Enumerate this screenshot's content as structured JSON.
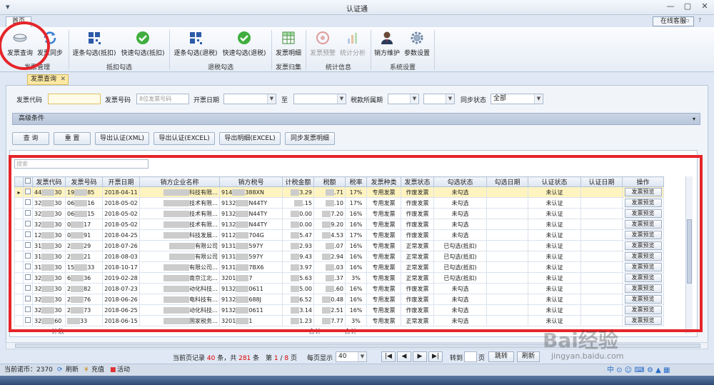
{
  "window": {
    "title": "认证通",
    "menu_tab": "首页",
    "online_service": "在线客服"
  },
  "ribbon": {
    "groups": [
      {
        "label": "发票管理",
        "buttons": [
          "发票查询",
          "发票同步"
        ]
      },
      {
        "label": "抵扣勾选",
        "buttons": [
          "逐条勾选(抵扣)",
          "快速勾选(抵扣)"
        ]
      },
      {
        "label": "退税勾选",
        "buttons": [
          "逐条勾选(退税)",
          "快速勾选(退税)"
        ]
      },
      {
        "label": "发票归集",
        "buttons": [
          "发票明细"
        ]
      },
      {
        "label": "统计信息",
        "buttons": [
          "发票预警",
          "统计分析"
        ]
      },
      {
        "label": "系统设置",
        "buttons": [
          "销方维护",
          "参数设置"
        ]
      }
    ]
  },
  "doc_tab": "发票查询",
  "filters": {
    "code_label": "发票代码",
    "number_label": "发票号码",
    "number_placeholder": "8位发票号码",
    "date_label": "开票日期",
    "to_label": "至",
    "period_label": "税款所属期",
    "sync_label": "同步状态",
    "sync_value": "全部"
  },
  "advanced": "高级条件",
  "actions": [
    "查 询",
    "重 置",
    "导出认证(XML)",
    "导出认证(EXCEL)",
    "导出明细(EXCEL)",
    "同步发票明细"
  ],
  "grid": {
    "search_placeholder": "搜索",
    "columns": [
      "发票代码",
      "发票号码",
      "开票日期",
      "销方企业名称",
      "销方税号",
      "计税金额",
      "税额",
      "税率",
      "发票种类",
      "发票状态",
      "勾选状态",
      "勾选日期",
      "认证状态",
      "认证日期",
      "操作"
    ],
    "action_label": "发票预览",
    "rows": [
      [
        "44",
        "30",
        "19",
        "85",
        "2018-04-11",
        "科技有限…",
        "914",
        "388XN",
        "3.29",
        ".71",
        "17%",
        "专用发票",
        "作废发票",
        "未勾选",
        "",
        "未认证"
      ],
      [
        "32",
        "30",
        "06",
        "16",
        "2018-05-02",
        "技术有限…",
        "9132",
        "N44TY",
        ".15",
        ".10",
        "17%",
        "专用发票",
        "作废发票",
        "未勾选",
        "",
        "未认证"
      ],
      [
        "32",
        "30",
        "06",
        "15",
        "2018-05-02",
        "技术有限…",
        "9132",
        "N44TY",
        "0.00",
        "7.20",
        "16%",
        "专用发票",
        "作废发票",
        "未勾选",
        "",
        "未认证"
      ],
      [
        "32",
        "30",
        "0",
        "17",
        "2018-05-02",
        "技术有限…",
        "9132",
        "N44TY",
        "0.00",
        "9.20",
        "16%",
        "专用发票",
        "作废发票",
        "未勾选",
        "",
        "未认证"
      ],
      [
        "12",
        "30",
        "0",
        "91",
        "2018-04-25",
        "科技发展…",
        "9112",
        "704G",
        "5.47",
        "4.53",
        "17%",
        "专用发票",
        "作废发票",
        "未勾选",
        "",
        "未认证"
      ],
      [
        "31",
        "30",
        "2",
        "29",
        "2018-07-26",
        "有限公司",
        "9131",
        "597Y",
        "2.93",
        ".07",
        "16%",
        "专用发票",
        "正常发票",
        "已勾选(抵扣)",
        "",
        "未认证"
      ],
      [
        "31",
        "30",
        "2",
        "21",
        "2018-08-03",
        "有限公司",
        "9131",
        "597Y",
        "9.43",
        "2.94",
        "16%",
        "专用发票",
        "正常发票",
        "已勾选(抵扣)",
        "",
        "未认证"
      ],
      [
        "31",
        "30",
        "15",
        "33",
        "2018-10-17",
        "有限公司…",
        "9131",
        "7BX6",
        "3.97",
        ".03",
        "16%",
        "专用发票",
        "正常发票",
        "已勾选(抵扣)",
        "",
        "未认证"
      ],
      [
        "32",
        "30",
        "6",
        "36",
        "2019-02-28",
        "南京江北…",
        "3201",
        "7",
        "5.63",
        ".37",
        "3%",
        "专用发票",
        "正常发票",
        "已勾选(抵扣)",
        "",
        "未认证"
      ],
      [
        "32",
        "30",
        "2",
        "82",
        "2018-07-23",
        "动化科技…",
        "9132",
        "0611",
        "5.00",
        ".60",
        "16%",
        "专用发票",
        "作废发票",
        "未勾选",
        "",
        "未认证"
      ],
      [
        "32",
        "30",
        "2",
        "76",
        "2018-06-26",
        "电科技有…",
        "9132",
        "688J",
        "6.52",
        "0.48",
        "16%",
        "专用发票",
        "作废发票",
        "未勾选",
        "",
        "未认证"
      ],
      [
        "32",
        "30",
        "2",
        "73",
        "2018-06-25",
        "动化科技…",
        "9132",
        "0611",
        "3.14",
        "2.51",
        "16%",
        "专用发票",
        "作废发票",
        "未勾选",
        "",
        "未认证"
      ],
      [
        "32",
        "60",
        "",
        "33",
        "2018-06-15",
        "国家税务…",
        "3201",
        "1",
        "1.23",
        "7.77",
        "3%",
        "专用发票",
        "正常发票",
        "未勾选",
        "",
        "未认证"
      ]
    ],
    "footer": [
      "计数",
      "合计",
      "合计"
    ]
  },
  "pager": {
    "prefix": "当前页记录",
    "page_count": "40",
    "mid": "条，共",
    "total": "281",
    "suffix": "条",
    "page_label": "第",
    "page_cur": "1",
    "page_sep": "/",
    "page_total": "8",
    "page_suffix": "页",
    "per_page_label": "每页显示",
    "per_page": "40",
    "goto_label": "转到",
    "page_unit": "页",
    "goto_btn": "跳转",
    "refresh": "刷新"
  },
  "status": {
    "coins": "当前诺币：2370",
    "refresh": "刷新",
    "recharge": "充值",
    "activity": "活动"
  },
  "watermark": {
    "brand": "Bai经验",
    "url": "jingyan.baidu.com"
  }
}
